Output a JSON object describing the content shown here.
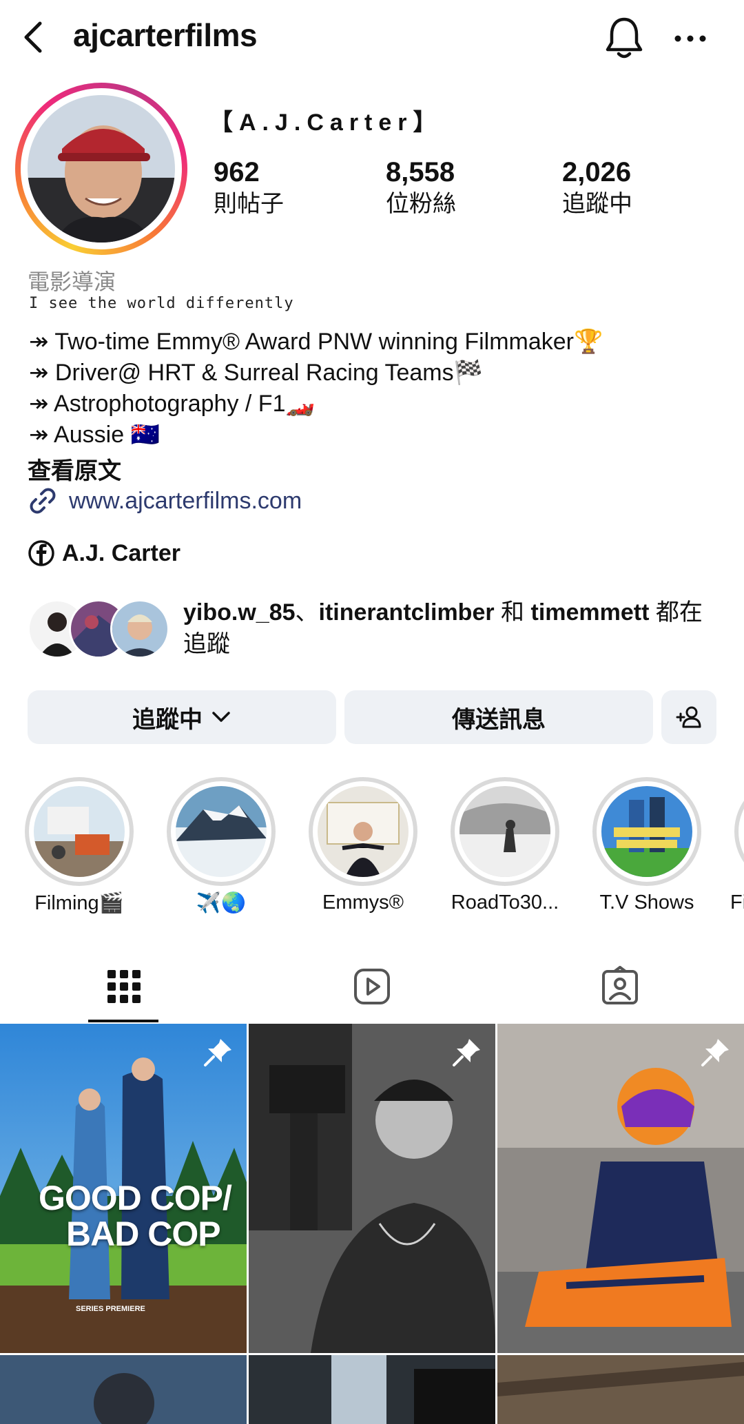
{
  "header": {
    "username": "ajcarterfilms",
    "back_icon": "chevron-left-icon",
    "notifications_icon": "bell-icon",
    "more_icon": "more-horizontal-icon"
  },
  "profile": {
    "display_name": "【A.J.Carter】",
    "stats": [
      {
        "value": "962",
        "label": "則帖子"
      },
      {
        "value": "8,558",
        "label": "位粉絲"
      },
      {
        "value": "2,026",
        "label": "追蹤中"
      }
    ],
    "category": "電影導演",
    "tagline": "I see the world differently",
    "bio_lines": [
      "↠ Two-time Emmy® Award PNW winning Filmmaker🏆",
      "↠ Driver@ HRT & Surreal Racing Teams🏁",
      "↠ Astrophotography / F1🏎️",
      "↠ Aussie 🇦🇺"
    ],
    "see_original": "查看原文",
    "website": "www.ajcarterfilms.com",
    "facebook": "A.J. Carter"
  },
  "followed_by": {
    "name1": "yibo.w_85",
    "sep1": "、",
    "name2": "itinerantclimber",
    "sep2": " 和 ",
    "name3": "timemmett",
    "suffix": " 都在追蹤"
  },
  "actions": {
    "following_label": "追蹤中",
    "message_label": "傳送訊息",
    "add_person_icon": "add-person-icon"
  },
  "highlights": [
    {
      "label": "Filming🎬"
    },
    {
      "label": "✈️🌏"
    },
    {
      "label": "Emmys®"
    },
    {
      "label": "RoadTo30..."
    },
    {
      "label": "T.V Shows"
    },
    {
      "label": "Fil"
    }
  ],
  "posts": [
    {
      "text1": "GOOD COP/",
      "text2": "BAD COP",
      "footer": "SERIES PREMIERE",
      "pinned": true
    },
    {
      "pinned": true
    },
    {
      "pinned": true
    }
  ],
  "colors": {
    "link": "#2d3a6e",
    "button_bg": "#eef1f5",
    "muted": "#8a8a8a"
  }
}
